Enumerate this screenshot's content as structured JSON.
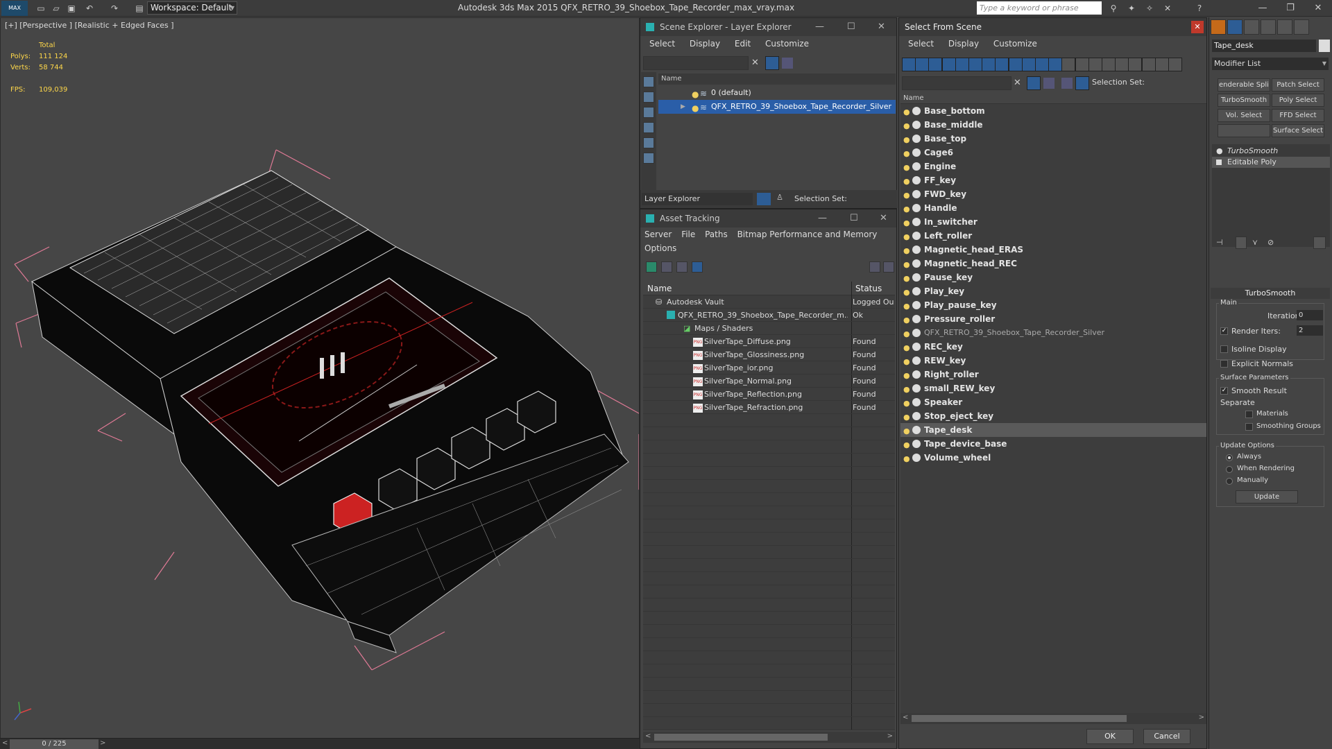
{
  "titlebar": {
    "logo": "MAX",
    "workspace": "Workspace: Default",
    "title": "Autodesk 3ds Max  2015    QFX_RETRO_39_Shoebox_Tape_Recorder_max_vray.max",
    "search_placeholder": "Type a keyword or phrase"
  },
  "viewport": {
    "label": "[+] [Perspective ] [Realistic + Edged Faces ]",
    "stats": {
      "total_label": "Total",
      "polys_label": "Polys:",
      "polys_value": "111 124",
      "verts_label": "Verts:",
      "verts_value": "58 744",
      "fps_label": "FPS:",
      "fps_value": "109,039"
    }
  },
  "timeslider": {
    "value": "0 / 225"
  },
  "scene_explorer": {
    "title": "Scene Explorer - Layer Explorer",
    "menu": [
      "Select",
      "Display",
      "Edit",
      "Customize"
    ],
    "column": "Name",
    "rows": [
      "0 (default)",
      "QFX_RETRO_39_Shoebox_Tape_Recorder_Silver"
    ],
    "bottom_dropdown": "Layer Explorer",
    "selection_set": "Selection Set:"
  },
  "asset_tracking": {
    "title": "Asset Tracking",
    "menu": [
      "Server",
      "File",
      "Paths",
      "Bitmap Performance and Memory"
    ],
    "menu2": "Options",
    "columns": {
      "name": "Name",
      "status": "Status"
    },
    "rows": [
      {
        "name": "Autodesk Vault",
        "status": "Logged Ou"
      },
      {
        "name": "QFX_RETRO_39_Shoebox_Tape_Recorder_m...",
        "status": "Ok"
      },
      {
        "name": "Maps / Shaders",
        "status": ""
      },
      {
        "name": "SilverTape_Diffuse.png",
        "status": "Found"
      },
      {
        "name": "SilverTape_Glossiness.png",
        "status": "Found"
      },
      {
        "name": "SilverTape_ior.png",
        "status": "Found"
      },
      {
        "name": "SilverTape_Normal.png",
        "status": "Found"
      },
      {
        "name": "SilverTape_Reflection.png",
        "status": "Found"
      },
      {
        "name": "SilverTape_Refraction.png",
        "status": "Found"
      }
    ],
    "png_label": "PNG"
  },
  "select_from_scene": {
    "title": "Select From Scene",
    "menu": [
      "Select",
      "Display",
      "Customize"
    ],
    "selection_set": "Selection Set:",
    "column": "Name",
    "objects": [
      "Base_bottom",
      "Base_middle",
      "Base_top",
      "Cage6",
      "Engine",
      "FF_key",
      "FWD_key",
      "Handle",
      "In_switcher",
      "Left_roller",
      "Magnetic_head_ERAS",
      "Magnetic_head_REC",
      "Pause_key",
      "Play_key",
      "Play_pause_key",
      "Pressure_roller",
      "QFX_RETRO_39_Shoebox_Tape_Recorder_Silver",
      "REC_key",
      "REW_key",
      "Right_roller",
      "small_REW_key",
      "Speaker",
      "Stop_eject_key",
      "Tape_desk",
      "Tape_device_base",
      "Volume_wheel"
    ],
    "ok": "OK",
    "cancel": "Cancel"
  },
  "command_panel": {
    "object_name": "Tape_desk",
    "modifier_list": "Modifier List",
    "buttons": [
      "enderable Spli",
      "Patch Select",
      "TurboSmooth",
      "Poly Select",
      "Vol. Select",
      "FFD Select",
      "",
      "Surface Select"
    ],
    "stack": [
      "TurboSmooth",
      "Editable Poly"
    ],
    "rollout": "TurboSmooth",
    "main": "Main",
    "iterations_label": "Iterations:",
    "iterations_value": "0",
    "render_iters_label": "Render Iters:",
    "render_iters_value": "2",
    "isoline": "Isoline Display",
    "explicit_normals": "Explicit Normals",
    "surface_params": "Surface Parameters",
    "smooth_result": "Smooth Result",
    "separate": "Separate",
    "materials": "Materials",
    "smoothing_groups": "Smoothing Groups",
    "update_options": "Update Options",
    "always": "Always",
    "when_rendering": "When Rendering",
    "manually": "Manually",
    "update": "Update"
  }
}
